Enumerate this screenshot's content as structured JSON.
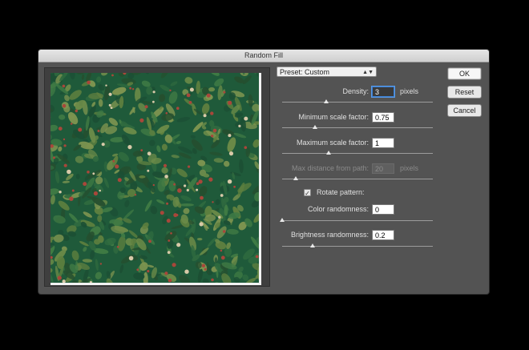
{
  "dialog": {
    "title": "Random Fill"
  },
  "preset": {
    "label": "Preset: Custom",
    "chevron_icon": "chevron-updown-icon"
  },
  "buttons": {
    "ok": "OK",
    "reset": "Reset",
    "cancel": "Cancel"
  },
  "density": {
    "label": "Density:",
    "value": "3",
    "unit": "pixels",
    "slider_level": 0.29
  },
  "min_scale": {
    "label": "Minimum scale factor:",
    "value": "0.75",
    "slider_level": 0.22
  },
  "max_scale": {
    "label": "Maximum scale factor:",
    "value": "1",
    "slider_level": 0.31
  },
  "max_distance": {
    "label": "Max distance from path:",
    "value": "20",
    "unit": "pixels",
    "slider_level": 0.09,
    "disabled": true
  },
  "rotate": {
    "label": "Rotate pattern:",
    "checked": true,
    "check_glyph": "✓"
  },
  "color_randomness": {
    "label": "Color randomness:",
    "value": "0",
    "slider_level": 0.0
  },
  "brightness_randomness": {
    "label": "Brightness randomness:",
    "value": "0.2",
    "slider_level": 0.2
  },
  "colors": {
    "dialog_bg": "#535353",
    "focus_ring": "#3c7fd1",
    "leaf_dark": "#1f5a3a",
    "leaf_light": "#6f8a45",
    "berry": "#a8473a"
  }
}
